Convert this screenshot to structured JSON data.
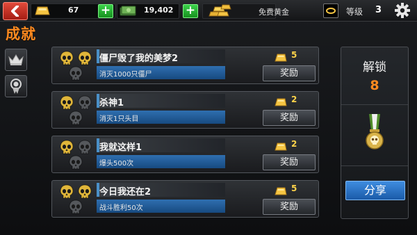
{
  "topbar": {
    "gold_count": "67",
    "cash_count": "19,402",
    "free_gold_label": "免费黄金",
    "level_label": "等级",
    "level_value": "3"
  },
  "page": {
    "title": "成就"
  },
  "achievements": [
    {
      "title": "僵尸毁了我的美梦2",
      "progress_text": "消灭1000只僵尸",
      "reward": "5",
      "claim_label": "奖励",
      "progress": 1.0,
      "gold_skulls": 2
    },
    {
      "title": "杀神1",
      "progress_text": "消灭1只头目",
      "reward": "2",
      "claim_label": "奖励",
      "progress": 1.0,
      "gold_skulls": 1
    },
    {
      "title": "我就这样1",
      "progress_text": "爆头500次",
      "reward": "2",
      "claim_label": "奖励",
      "progress": 1.0,
      "gold_skulls": 1
    },
    {
      "title": "今日我还在2",
      "progress_text": "战斗胜利50次",
      "reward": "5",
      "claim_label": "奖励",
      "progress": 1.0,
      "gold_skulls": 2
    }
  ],
  "right_panel": {
    "unlock_label": "解锁",
    "unlock_count": "8",
    "share_label": "分享"
  },
  "colors": {
    "accent_orange": "#ff8a1f",
    "reward_yellow": "#ffd34a",
    "progress_blue": "#2f6fb0"
  }
}
